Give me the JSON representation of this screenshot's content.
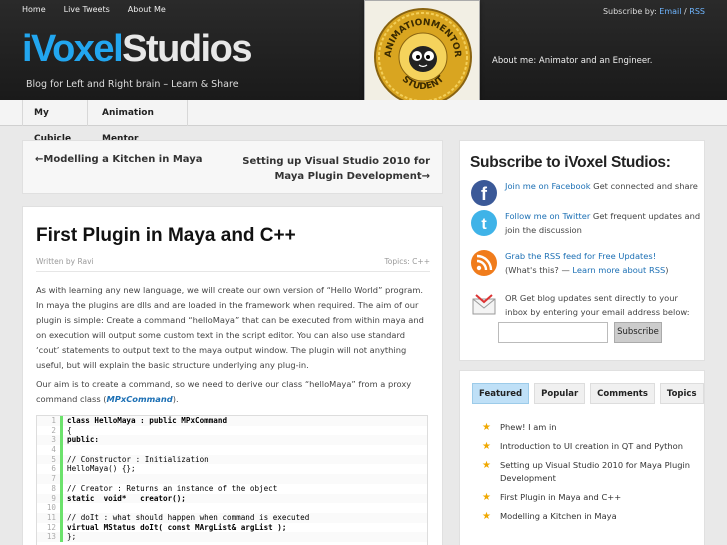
{
  "topnav": {
    "items": [
      "Home",
      "Live Tweets",
      "About Me"
    ]
  },
  "subscribe_by": {
    "label": "Subscribe by:",
    "email": "Email",
    "sep": "/",
    "rss": "RSS"
  },
  "logo": {
    "part1": "iVoxel",
    "part2": "Studios"
  },
  "tagline": "Blog for Left and Right brain – Learn & Share",
  "about_me": "About me: Animator and an Engineer.",
  "badge": {
    "top_text": "ANIMATIONMENTOR",
    "bottom_text": "STUDENT"
  },
  "navbar": {
    "items": [
      "My Cubicle",
      "Animation Mentor"
    ]
  },
  "postnav": {
    "prev": "←Modelling a Kitchen in Maya",
    "next": "Setting up Visual Studio 2010 for Maya Plugin Development→"
  },
  "post": {
    "title": "First Plugin in Maya and C++",
    "written_by": "Written by Ravi",
    "topics": "Topics: C++",
    "para1": "As with learning any new language, we will create our own version of “Hello World” program. In maya the plugins are dlls and are loaded in the framework when required. The aim of our plugin is simple: Create a command “helloMaya” that can be executed from within maya and on execution will output some custom text in the script editor. You can also use standard ‘cout’ statements to output text to the maya output window. The plugin will not anything useful, but will explain the basic structure underlying any plug-in.",
    "para2_before": "Our aim is to create a command, so we need to derive our class “helloMaya” from a proxy command class (",
    "para2_link": "MPxCommand",
    "para2_after": ")."
  },
  "code": {
    "lines": [
      {
        "n": "1",
        "t": "class HelloMaya : public MPxCommand",
        "style": "kw"
      },
      {
        "n": "2",
        "t": "{",
        "style": ""
      },
      {
        "n": "3",
        "t": "public:",
        "style": "kw"
      },
      {
        "n": "4",
        "t": "",
        "style": ""
      },
      {
        "n": "5",
        "t": "// Constructor : Initialization",
        "style": "cm"
      },
      {
        "n": "6",
        "t": "HelloMaya() {};",
        "style": ""
      },
      {
        "n": "7",
        "t": "",
        "style": ""
      },
      {
        "n": "8",
        "t": "// Creator : Returns an instance of the object",
        "style": "cm"
      },
      {
        "n": "9",
        "t": "static  void*   creator();",
        "style": "kw"
      },
      {
        "n": "10",
        "t": "",
        "style": ""
      },
      {
        "n": "11",
        "t": "// doIt : what should happen when command is executed",
        "style": "cm"
      },
      {
        "n": "12",
        "t": "virtual MStatus doIt( const MArgList& argList );",
        "style": "kw"
      },
      {
        "n": "13",
        "t": "};",
        "style": ""
      }
    ]
  },
  "sidebar": {
    "title": "Subscribe to iVoxel Studios:",
    "facebook": {
      "link": "Join me on Facebook",
      "text": " Get connected and share"
    },
    "twitter": {
      "link": "Follow me on Twitter",
      "text": " Get frequent updates and join the discussion"
    },
    "rss": {
      "link": "Grab the RSS feed for Free Updates!",
      "text2": "(What's this? — ",
      "link2": "Learn more about RSS",
      "text3": ")"
    },
    "email": {
      "text": "OR Get blog updates sent directly to your inbox by entering your email address below:",
      "placeholder": "",
      "button": "Subscribe"
    }
  },
  "tabs": {
    "items": [
      "Featured",
      "Popular",
      "Comments",
      "Topics"
    ],
    "active": "Featured",
    "featured": [
      "Phew! I am in",
      "Introduction to UI creation in QT and Python",
      "Setting up Visual Studio 2010 for Maya Plugin Development",
      "First Plugin in Maya and C++",
      "Modelling a Kitchen in Maya"
    ]
  },
  "colors": {
    "accent": "#22a6ef",
    "link": "#1b6fb4",
    "header_bg": "#222222",
    "active_tab": "#bfe0f7"
  }
}
